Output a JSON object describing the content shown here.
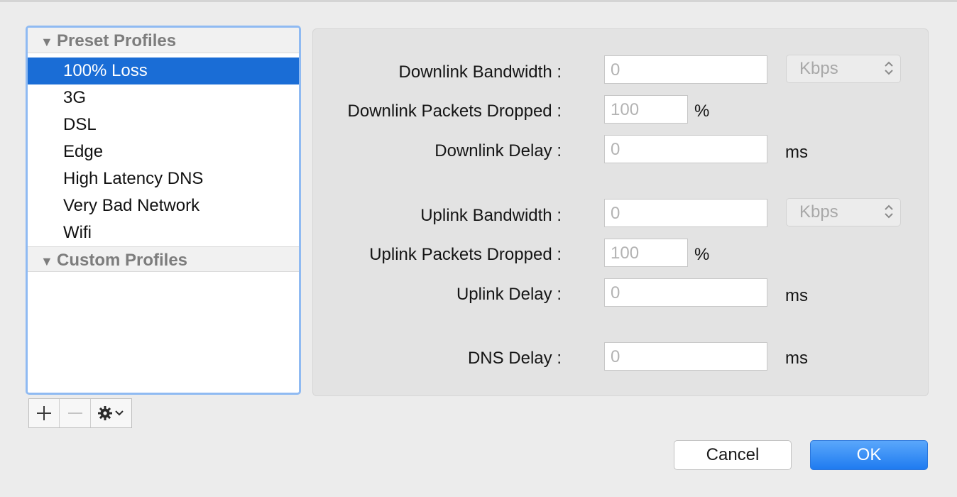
{
  "source_list": {
    "preset_header": "Preset Profiles",
    "presets": [
      "100% Loss",
      "3G",
      "DSL",
      "Edge",
      "High Latency DNS",
      "Very Bad Network",
      "Wifi"
    ],
    "selected_index": 0,
    "custom_header": "Custom Profiles"
  },
  "list_buttons": {
    "add_icon": "plus-icon",
    "remove_icon": "minus-icon",
    "action_icon": "gear-icon"
  },
  "fields": {
    "downlink_bandwidth": {
      "label": "Downlink Bandwidth :",
      "value": "0",
      "unit": "Kbps"
    },
    "downlink_packets_dropped": {
      "label": "Downlink Packets Dropped :",
      "value": "100",
      "unit": "%"
    },
    "downlink_delay": {
      "label": "Downlink Delay :",
      "value": "0",
      "unit": "ms"
    },
    "uplink_bandwidth": {
      "label": "Uplink Bandwidth :",
      "value": "0",
      "unit": "Kbps"
    },
    "uplink_packets_dropped": {
      "label": "Uplink Packets Dropped :",
      "value": "100",
      "unit": "%"
    },
    "uplink_delay": {
      "label": "Uplink Delay :",
      "value": "0",
      "unit": "ms"
    },
    "dns_delay": {
      "label": "DNS Delay :",
      "value": "0",
      "unit": "ms"
    }
  },
  "dialog": {
    "cancel_label": "Cancel",
    "ok_label": "OK"
  },
  "colors": {
    "selection": "#1a6dd6",
    "focus_ring": "#8fbaf2",
    "ok_button": "#1f7bf0"
  }
}
